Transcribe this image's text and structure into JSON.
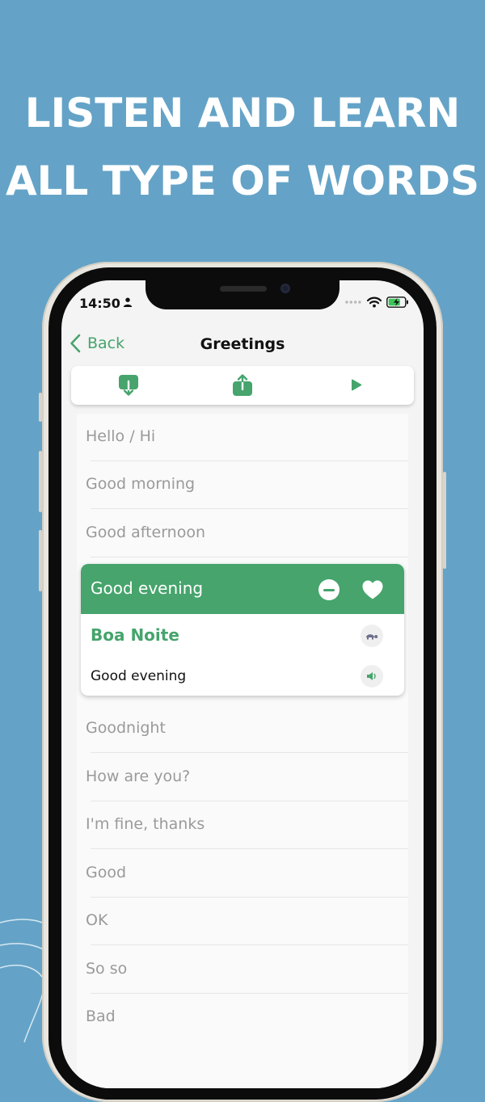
{
  "promo": {
    "headline_line1": "LISTEN AND LEARN",
    "headline_line2": "ALL TYPE OF WORDS"
  },
  "status_bar": {
    "time": "14:50",
    "icons": [
      "person-icon",
      "signal-dots-icon",
      "wifi-icon",
      "battery-charging-icon"
    ]
  },
  "nav": {
    "back_label": "Back",
    "title": "Greetings"
  },
  "toolbar": {
    "buttons": [
      "download-icon",
      "share-icon",
      "play-icon"
    ]
  },
  "phrases_before": [
    "Hello / Hi",
    "Good morning",
    "Good afternoon"
  ],
  "expanded": {
    "phrase": "Good evening",
    "translation": "Boa Noite",
    "original": "Good evening",
    "icons": [
      "remove-icon",
      "heart-icon",
      "turtle-slow-icon",
      "speaker-icon"
    ]
  },
  "phrases_after": [
    "Goodnight",
    "How are you?",
    "I'm fine, thanks",
    "Good",
    "OK",
    "So so",
    "Bad"
  ],
  "colors": {
    "background": "#64A3C7",
    "accent": "#46A46C",
    "screen": "#F4F4F4",
    "muted_text": "#9A9A9A"
  }
}
